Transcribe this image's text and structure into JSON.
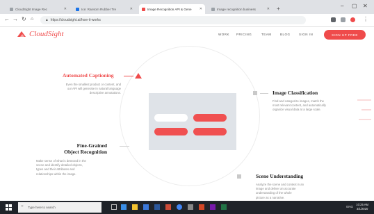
{
  "browser": {
    "tabs": [
      {
        "label": "CloudSight Image Rec",
        "favicon_color": "#9aa0a6",
        "active": false
      },
      {
        "label": "Ice: Ransom Rubber Tre",
        "favicon_color": "#1a73e8",
        "active": false
      },
      {
        "label": "Image Recognition API & Gene",
        "favicon_color": "#ef4b4b",
        "active": true
      },
      {
        "label": "Image recognition business",
        "favicon_color": "#9aa0a6",
        "active": false
      }
    ],
    "new_tab": "+",
    "url": "https://cloudsight.ai/how-it-works",
    "window_controls": [
      "–",
      "▢",
      "✕"
    ]
  },
  "site": {
    "logo_text": "CloudSight",
    "nav": [
      "WORK",
      "PRICING",
      "TEAM",
      "BLOG",
      "SIGN IN"
    ],
    "cta": "SIGN UP FREE",
    "accent": "#ef4b4b"
  },
  "features": {
    "captioning": {
      "title": "Automated Captioning",
      "desc": [
        "Even the smallest product or content, and",
        "our API will generate in natural language",
        "descriptive annotations."
      ]
    },
    "classification": {
      "title": "Image Classification",
      "desc": [
        "Find and categorize images, match the",
        "most relevant content, and automatically",
        "organize visual data at a large scale."
      ]
    },
    "fine_grained": {
      "title": [
        "Fine-Grained",
        "Object Recognition"
      ],
      "desc": [
        "Make sense of what is detected in the",
        "scene and identify detailed objects,",
        "types and their attributes and",
        "relationships within the image."
      ]
    },
    "scene": {
      "title": "Scene Understanding",
      "desc": [
        "Analyze the scene and context in an",
        "image and deliver an accurate",
        "understanding of the whole",
        "picture as a narrative."
      ]
    }
  },
  "mockup": {
    "pill_colors": [
      "#ffffff",
      "#f05050",
      "#f05050",
      "#f05050"
    ]
  },
  "taskbar": {
    "search_placeholder": "Type here to search",
    "tray_text": "ENG",
    "time": "10:25 AM",
    "date": "3/1/2020"
  }
}
